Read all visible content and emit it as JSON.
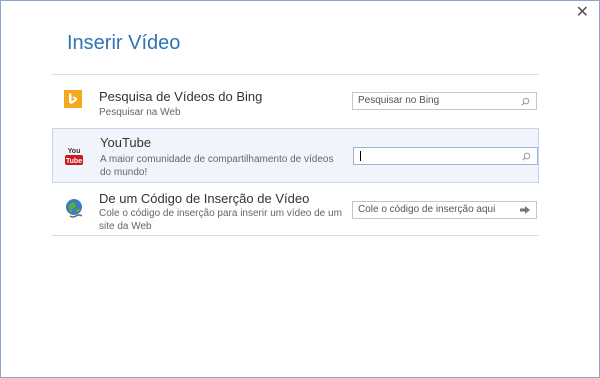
{
  "dialog": {
    "title": "Inserir Vídeo",
    "close_icon": "close-icon"
  },
  "bing": {
    "name": "Pesquisa de Vídeos do Bing",
    "description": "Pesquisar na Web",
    "placeholder": "Pesquisar no Bing",
    "icon": "bing-icon",
    "brand_color": "#f5a81c"
  },
  "youtube": {
    "name": "YouTube",
    "description": "A maior comunidade de compartilhamento de vídeos do mundo!",
    "value": "",
    "icon": "youtube-icon",
    "icon_label_top": "You",
    "icon_label_bottom": "Tube",
    "brand_color": "#cc181e"
  },
  "embed": {
    "name": "De um Código de Inserção de Vídeo",
    "description": "Cole o código de inserção para inserir um vídeo de um site da Web",
    "placeholder": "Cole o código de inserção aqui",
    "icon": "globe-link-icon"
  }
}
